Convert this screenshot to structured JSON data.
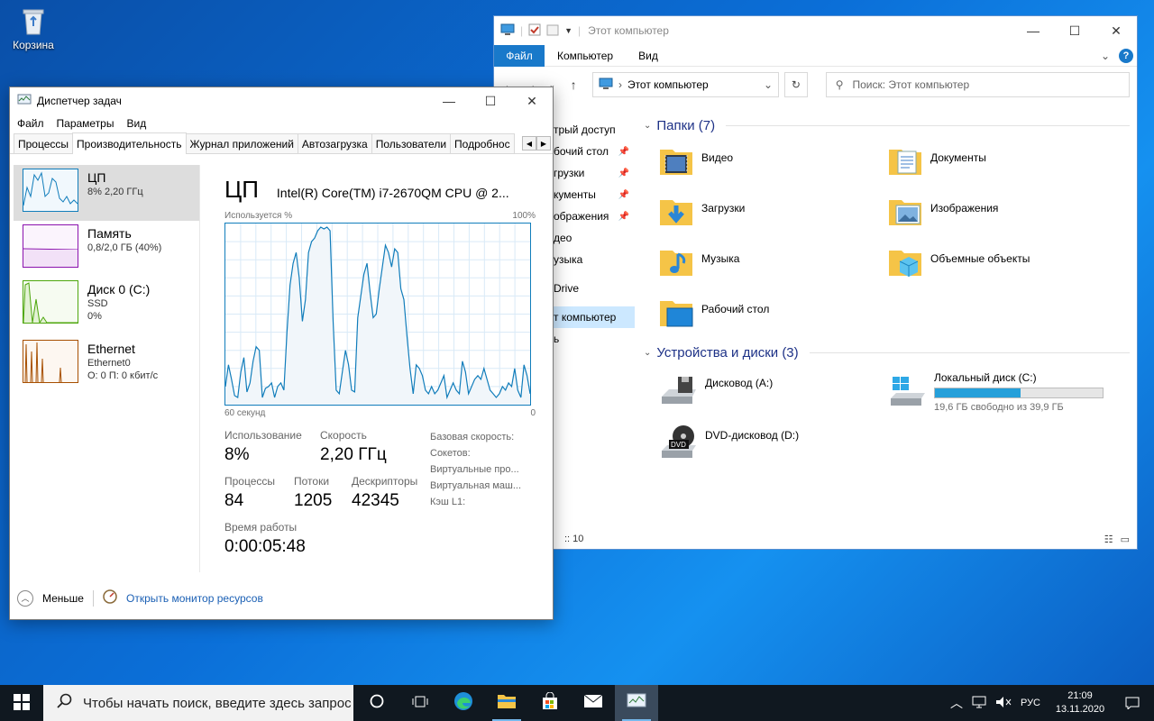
{
  "desktop": {
    "recycle_bin": "Корзина"
  },
  "explorer": {
    "title": "Этот компьютер",
    "ribbon": {
      "file": "Файл",
      "computer": "Компьютер",
      "view": "Вид"
    },
    "address": "Этот компьютер",
    "search_placeholder": "Поиск: Этот компьютер",
    "nav": [
      {
        "label": "трый доступ",
        "pinned": false
      },
      {
        "label": "бочий стол",
        "pinned": true
      },
      {
        "label": "грузки",
        "pinned": true
      },
      {
        "label": "кументы",
        "pinned": true
      },
      {
        "label": "ображения",
        "pinned": true
      },
      {
        "label": "део",
        "pinned": false
      },
      {
        "label": "узыка",
        "pinned": false
      },
      {
        "label": "Drive",
        "pinned": false
      },
      {
        "label": "т компьютер",
        "pinned": false
      },
      {
        "label": "ь",
        "pinned": false
      }
    ],
    "folders_header": "Папки (7)",
    "folders": [
      "Видео",
      "Документы",
      "Загрузки",
      "Изображения",
      "Музыка",
      "Объемные объекты",
      "Рабочий стол"
    ],
    "drives_header": "Устройства и диски (3)",
    "drives": {
      "floppy": "Дисковод (A:)",
      "local": "Локальный диск (C:)",
      "local_free": "19,6 ГБ свободно из 39,9 ГБ",
      "local_used_fraction": 0.51,
      "dvd": "DVD-дисковод (D:)",
      "dvd_badge": "DVD"
    },
    "status": ":: 10"
  },
  "taskmgr": {
    "title": "Диспетчер задач",
    "menu": [
      "Файл",
      "Параметры",
      "Вид"
    ],
    "tabs": [
      "Процессы",
      "Производительность",
      "Журнал приложений",
      "Автозагрузка",
      "Пользователи",
      "Подробнос"
    ],
    "resources": [
      {
        "name": "ЦП",
        "sub1": "8% 2,20 ГГц",
        "sub2": "",
        "color": "#117dbb"
      },
      {
        "name": "Память",
        "sub1": "0,8/2,0 ГБ (40%)",
        "sub2": "",
        "color": "#8b12ae"
      },
      {
        "name": "Диск 0 (C:)",
        "sub1": "SSD",
        "sub2": "0%",
        "color": "#4da60c"
      },
      {
        "name": "Ethernet",
        "sub1": "Ethernet0",
        "sub2": "О: 0 П: 0 кбит/с",
        "color": "#a74f01"
      }
    ],
    "cpu": {
      "heading": "ЦП",
      "model": "Intel(R) Core(TM) i7-2670QM CPU @ 2...",
      "usage_label": "Используется %",
      "max_label": "100%",
      "time_label": "60 секунд",
      "zero_label": "0",
      "usage_series": [
        10,
        22,
        14,
        5,
        4,
        18,
        26,
        7,
        12,
        24,
        32,
        30,
        4,
        9,
        10,
        12,
        4,
        10,
        12,
        8,
        40,
        66,
        78,
        84,
        70,
        46,
        58,
        84,
        90,
        92,
        96,
        98,
        97,
        98,
        96,
        46,
        8,
        6,
        18,
        30,
        22,
        8,
        7,
        48,
        60,
        72,
        78,
        62,
        48,
        50,
        64,
        76,
        88,
        84,
        76,
        86,
        84,
        64,
        58,
        38,
        20,
        6,
        22,
        20,
        16,
        8,
        6,
        10,
        6,
        8,
        12,
        16,
        4,
        8,
        12,
        8,
        6,
        24,
        18,
        6,
        10,
        14,
        16,
        14,
        20,
        14,
        8,
        6,
        4,
        6,
        10,
        8,
        12,
        10,
        20,
        8,
        4,
        22,
        16,
        6
      ]
    },
    "stats": {
      "usage_label": "Использование",
      "usage_value": "8%",
      "speed_label": "Скорость",
      "speed_value": "2,20 ГГц",
      "processes_label": "Процессы",
      "processes_value": "84",
      "threads_label": "Потоки",
      "threads_value": "1205",
      "handles_label": "Дескрипторы",
      "handles_value": "42345",
      "uptime_label": "Время работы",
      "uptime_value": "0:00:05:48"
    },
    "specs": [
      "Базовая скорость:",
      "Сокетов:",
      "Виртуальные про...",
      "Виртуальная маш...",
      "Кэш L1:"
    ],
    "footer": {
      "less": "Меньше",
      "monitor": "Открыть монитор ресурсов"
    }
  },
  "taskbar": {
    "search_placeholder": "Чтобы начать поиск, введите здесь запрос",
    "lang": "РУС",
    "time": "21:09",
    "date": "13.11.2020"
  },
  "colors": {
    "accent": "#1979ca",
    "cpu": "#117dbb",
    "memory": "#8b12ae",
    "disk": "#4da60c",
    "ethernet": "#a74f01"
  }
}
